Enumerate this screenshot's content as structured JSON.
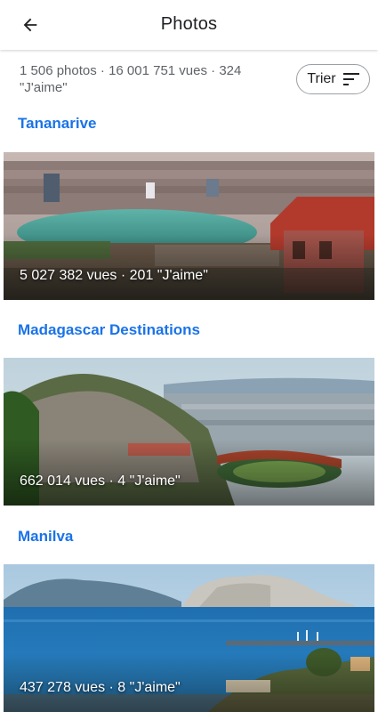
{
  "appbar": {
    "title": "Photos",
    "back_icon": "arrow-left-icon"
  },
  "summary": {
    "stats": "1 506 photos · 16 001 751 vues · 324 \"J'aime\"",
    "sort_label": "Trier",
    "sort_icon": "sort-icon"
  },
  "albums": [
    {
      "title": "Tananarive",
      "stats": "5 027 382 vues · 201 \"J'aime\""
    },
    {
      "title": "Madagascar Destinations",
      "stats": "662 014 vues · 4 \"J'aime\""
    },
    {
      "title": "Manilva",
      "stats": "437 278 vues · 8 \"J'aime\""
    }
  ],
  "colors": {
    "accent": "#1a73e8",
    "secondary_text": "#5f6368",
    "chip_border": "#9aa0a6"
  }
}
